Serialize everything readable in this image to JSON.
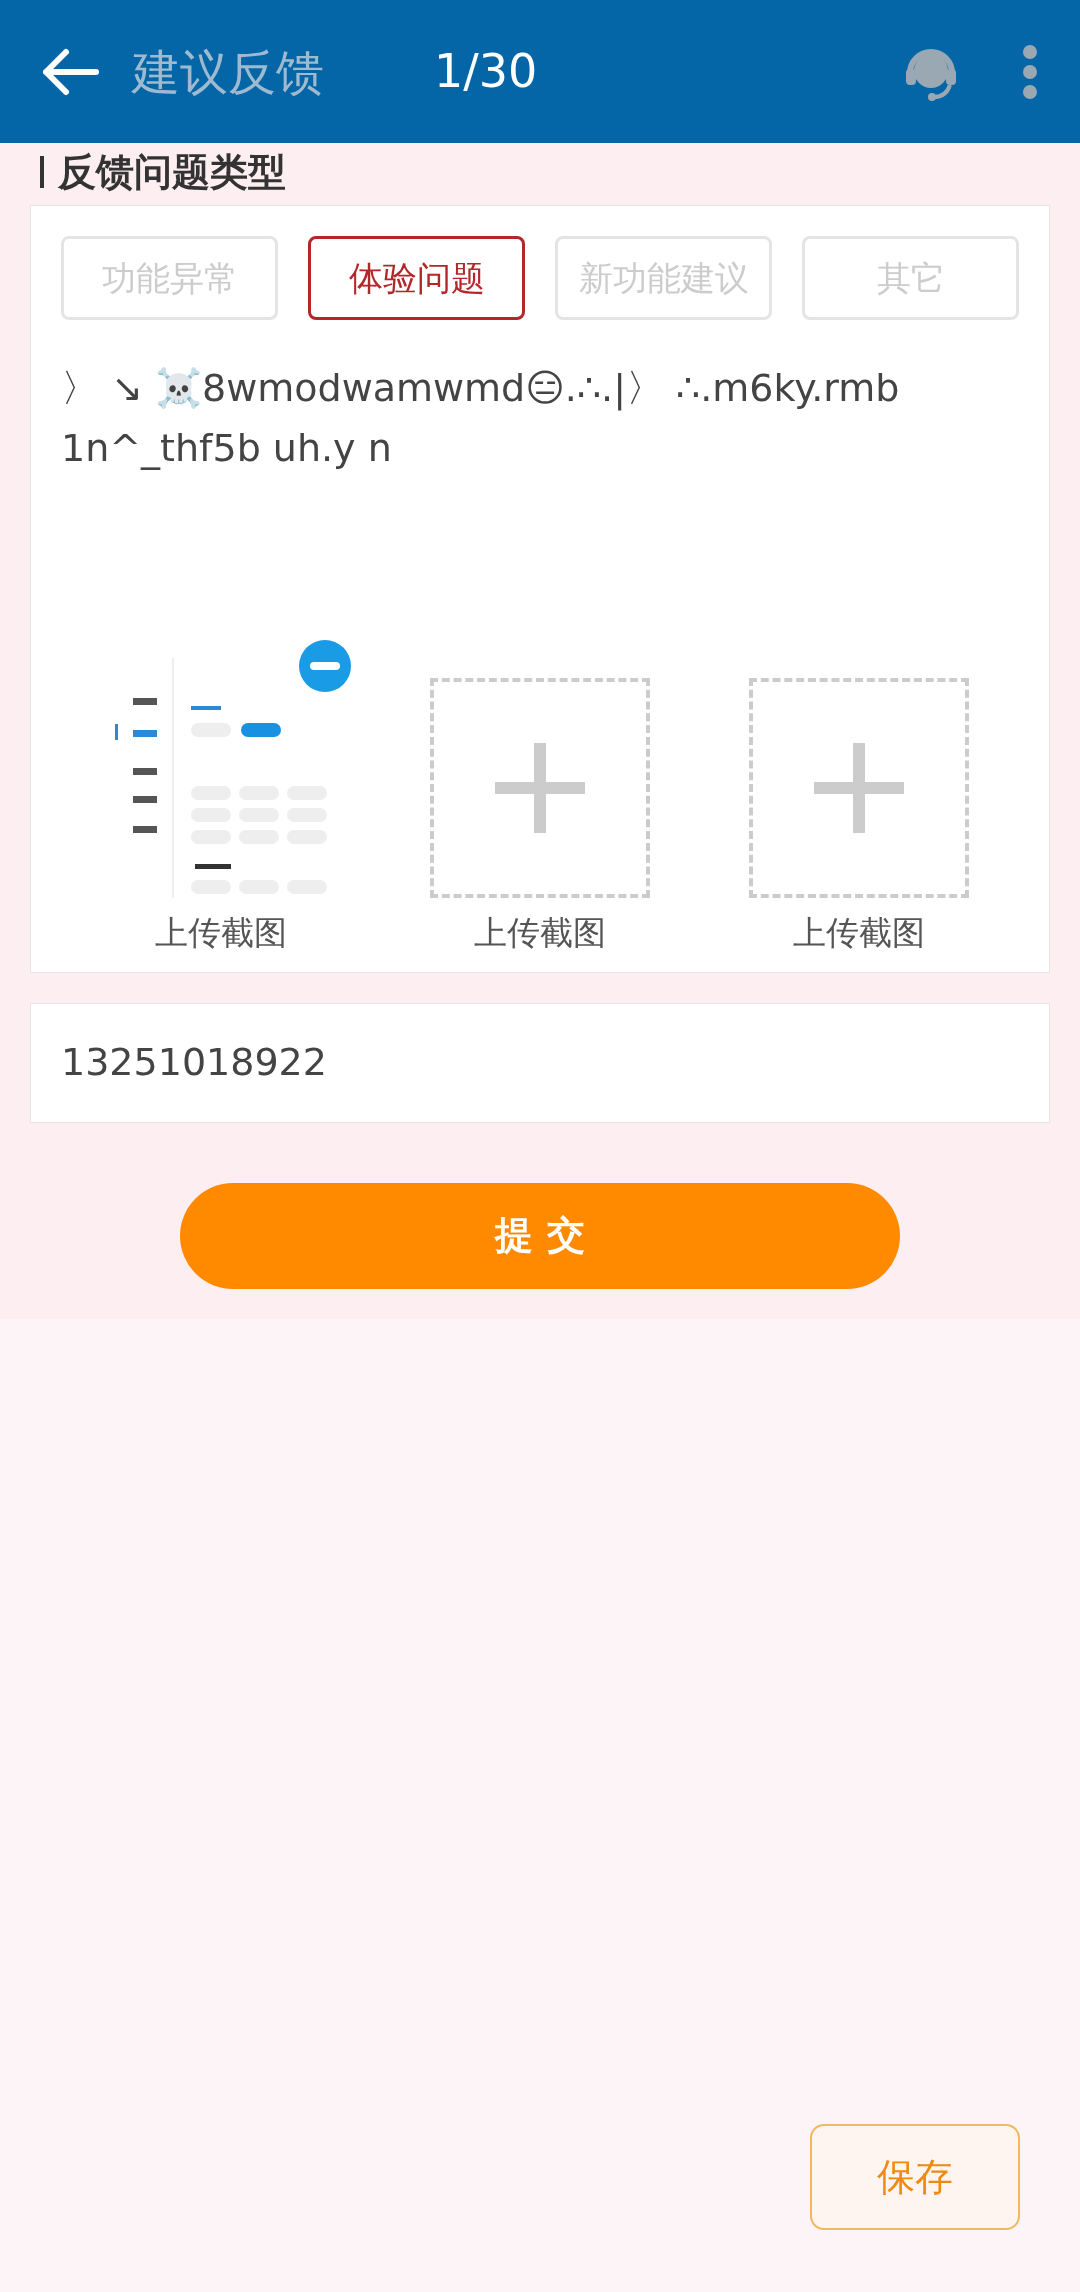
{
  "header": {
    "title": "建议反馈",
    "counter": "1/30"
  },
  "section_title": "反馈问题类型",
  "categories": [
    {
      "label": "功能异常",
      "selected": false
    },
    {
      "label": "体验问题",
      "selected": true
    },
    {
      "label": "新功能建议",
      "selected": false
    },
    {
      "label": "其它",
      "selected": false
    }
  ],
  "feedback_text": "〉 ↘ ☠️8wmodwamwmd😑.∴.|〉 ∴.m6ky.rmb\n1n^_thf5b uh.y n",
  "uploads": [
    {
      "kind": "image",
      "label": "上传截图"
    },
    {
      "kind": "empty",
      "label": "上传截图"
    },
    {
      "kind": "empty",
      "label": "上传截图"
    }
  ],
  "phone": "13251018922",
  "submit": "提 交",
  "save": "保存"
}
